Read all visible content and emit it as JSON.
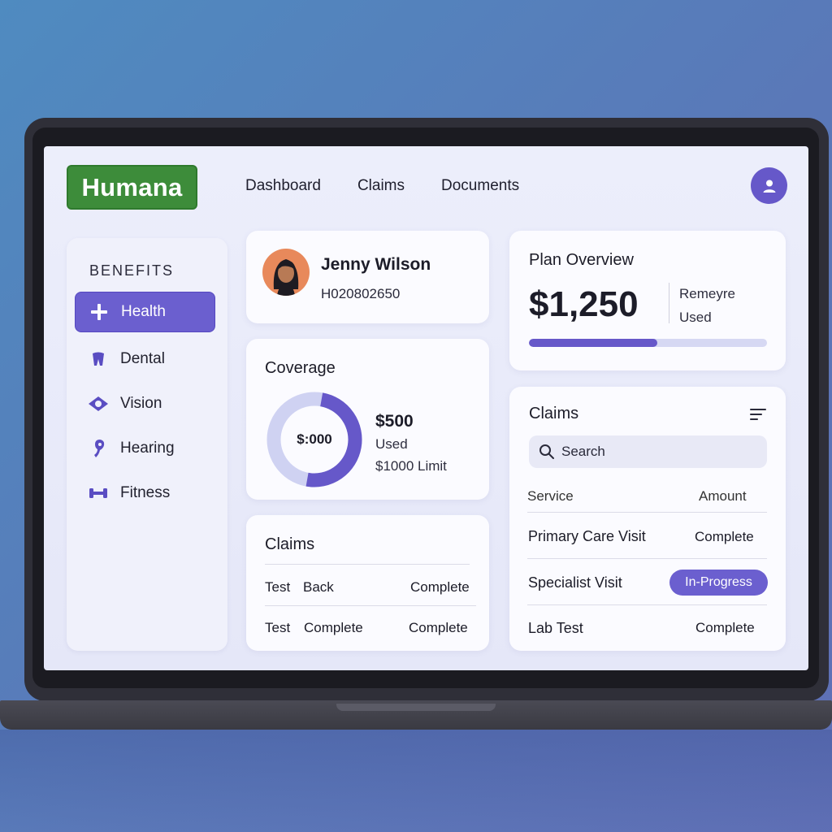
{
  "brand": {
    "logo_text": "Humana",
    "logo_color": "#3d8c3a",
    "accent": "#6658c9"
  },
  "nav": {
    "items": [
      "Dashboard",
      "Claims",
      "Documents"
    ]
  },
  "user_icon": "user-icon",
  "sidebar": {
    "heading": "BENEFITS",
    "items": [
      {
        "label": "Health",
        "icon": "plus-icon",
        "active": true
      },
      {
        "label": "Dental",
        "icon": "tooth-icon",
        "active": false
      },
      {
        "label": "Vision",
        "icon": "eye-icon",
        "active": false
      },
      {
        "label": "Hearing",
        "icon": "ear-icon",
        "active": false
      },
      {
        "label": "Fitness",
        "icon": "dumbbell-icon",
        "active": false
      }
    ]
  },
  "profile": {
    "name": "Jenny Wilson",
    "member_id": "H020802650"
  },
  "coverage": {
    "title": "Coverage",
    "center_label": "$:000",
    "used_amount": "$500",
    "used_label": "Used",
    "limit_label": "$1000 Limit",
    "used_fraction": 0.5
  },
  "claims_small": {
    "title": "Claims",
    "rows": [
      {
        "a": "Test",
        "b": "Back",
        "status": "Complete"
      },
      {
        "a": "Test",
        "b": "Complete",
        "status": "Complete"
      }
    ]
  },
  "plan": {
    "title": "Plan Overview",
    "amount": "$1,250",
    "side_label_1": "Remeyre",
    "side_label_2": "Used",
    "progress_fraction": 0.54
  },
  "claims_table": {
    "title": "Claims",
    "filter_icon": "filter-icon",
    "search_placeholder": "Search",
    "columns": [
      "Service",
      "Amount"
    ],
    "rows": [
      {
        "service": "Primary Care Visit",
        "status": "Complete",
        "highlight": false
      },
      {
        "service": "Specialist Visit",
        "status": "In-Progress",
        "highlight": true
      },
      {
        "service": "Lab Test",
        "status": "Complete",
        "highlight": false
      }
    ]
  }
}
